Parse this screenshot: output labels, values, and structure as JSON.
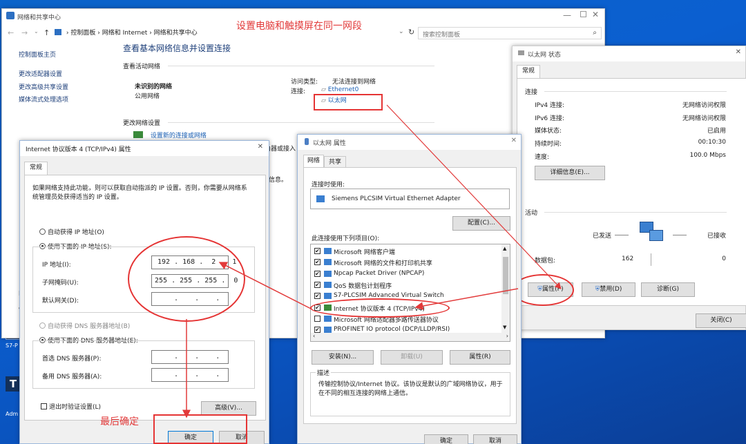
{
  "annotations": {
    "top_note": "设置电脑和触摸屏在同一网段",
    "bottom_note": "最后确定"
  },
  "network_center": {
    "title": "网络和共享中心",
    "breadcrumb": [
      "控制面板",
      "网络和 Internet",
      "网络和共享中心"
    ],
    "search_placeholder": "搜索控制面板",
    "sidebar": [
      "控制面板主页",
      "更改适配器设置",
      "更改高级共享设置",
      "媒体流式处理选项"
    ],
    "heading": "查看基本网络信息并设置连接",
    "active_networks_label": "查看活动网络",
    "network_name": "未识别的网络",
    "network_type": "公用网络",
    "access_type_label": "访问类型:",
    "access_type_value": "无法连接到网络",
    "connection_label": "连接:",
    "connections": [
      "Ethernet0",
      "以太网"
    ],
    "change_settings_label": "更改网络设置",
    "new_connection_link": "设置新的连接或网络",
    "partial_text_1": "由器或接入",
    "partial_text_2": "信息。"
  },
  "ethernet_status": {
    "title": "以太网 状态",
    "tab": "常规",
    "connection_label": "连接",
    "rows": [
      {
        "label": "IPv4 连接:",
        "value": "无网络访问权限"
      },
      {
        "label": "IPv6 连接:",
        "value": "无网络访问权限"
      },
      {
        "label": "媒体状态:",
        "value": "已启用"
      },
      {
        "label": "持续时间:",
        "value": "00:10:30"
      },
      {
        "label": "速度:",
        "value": "100.0 Mbps"
      }
    ],
    "details_button": "详细信息(E)...",
    "activity_label": "活动",
    "sent_label": "已发送",
    "received_label": "已接收",
    "packets_label": "数据包:",
    "sent_value": "162",
    "received_value": "0",
    "properties_button": "属性(P)",
    "disable_button": "禁用(D)",
    "diagnose_button": "诊断(G)",
    "close_button": "关闭(C)"
  },
  "ethernet_props": {
    "title": "以太网 属性",
    "tabs": [
      "网络",
      "共享"
    ],
    "connect_using_label": "连接时使用:",
    "adapter": "Siemens PLCSIM Virtual Ethernet Adapter",
    "configure_button": "配置(C)...",
    "items_label": "此连接使用下列项目(O):",
    "items": [
      {
        "label": "Microsoft 网络客户端",
        "checked": true
      },
      {
        "label": "Microsoft 网络的文件和打印机共享",
        "checked": true
      },
      {
        "label": "Npcap Packet Driver (NPCAP)",
        "checked": true
      },
      {
        "label": "QoS 数据包计划程序",
        "checked": true
      },
      {
        "label": "S7-PLCSIM Advanced Virtual Switch",
        "checked": true
      },
      {
        "label": "Internet 协议版本 4 (TCP/IPv4)",
        "checked": true
      },
      {
        "label": "Microsoft 网络适配器多路传送器协议",
        "checked": false
      },
      {
        "label": "PROFINET IO protocol (DCP/LLDP/RSI)",
        "checked": true
      }
    ],
    "install_button": "安装(N)...",
    "uninstall_button": "卸载(U)",
    "properties_button": "属性(R)",
    "description_label": "描述",
    "description": "传输控制协议/Internet 协议。该协议是默认的广域网络协议，用于在不同的相互连接的网络上通信。",
    "ok_button": "确定",
    "cancel_button": "取消"
  },
  "ipv4": {
    "title": "Internet 协议版本 4 (TCP/IPv4) 属性",
    "tab": "常规",
    "intro": "如果网络支持此功能，则可以获取自动指派的 IP 设置。否则，你需要从网络系统管理员处获得适当的 IP 设置。",
    "auto_ip": "自动获得 IP 地址(O)",
    "manual_ip": "使用下面的 IP 地址(S):",
    "ip_label": "IP 地址(I):",
    "ip_value": "192 . 168 .  2  . 1",
    "mask_label": "子网掩码(U):",
    "mask_value": "255 . 255 . 255 .  0",
    "gateway_label": "默认网关(D):",
    "gateway_value": " .    .    . ",
    "auto_dns": "自动获得 DNS 服务器地址(B)",
    "manual_dns": "使用下面的 DNS 服务器地址(E):",
    "dns1_label": "首选 DNS 服务器(P):",
    "dns2_label": "备用 DNS 服务器(A):",
    "dns_blank": " .    .    . ",
    "validate": "退出时验证设置(L)",
    "advanced_button": "高级(V)...",
    "ok_button": "确定",
    "cancel_button": "取消"
  },
  "desktop": {
    "icon_labels": [
      "S7-P",
      "Adm"
    ]
  }
}
